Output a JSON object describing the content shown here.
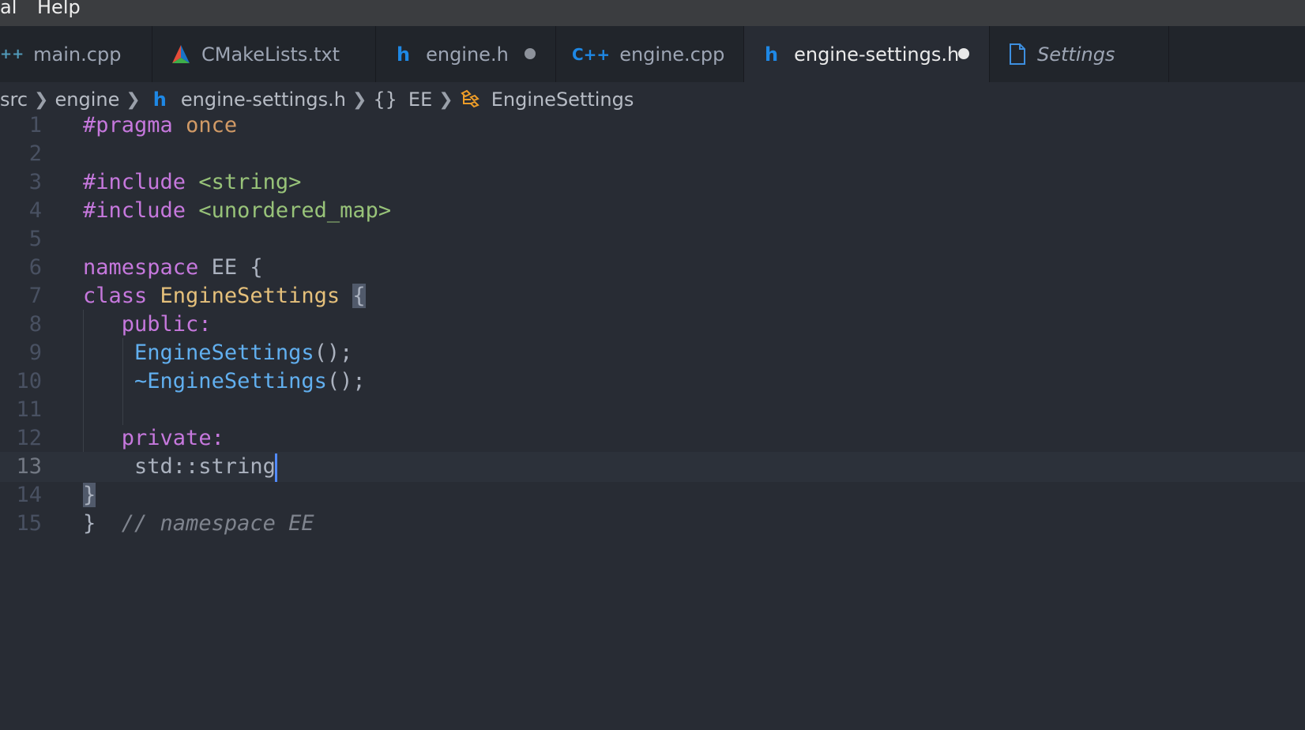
{
  "menubar": {
    "items": [
      {
        "label": "al"
      },
      {
        "label": "Help"
      }
    ]
  },
  "tabs": [
    {
      "label": "main.cpp",
      "icon": "cpp-icon",
      "icon_text": "++",
      "icon_color": "#519aba",
      "dirty": false,
      "active": false,
      "italic": false
    },
    {
      "label": "CMakeLists.txt",
      "icon": "cmake-icon",
      "icon_text": "",
      "icon_color": "#e44d3a",
      "dirty": false,
      "active": false,
      "italic": false
    },
    {
      "label": "engine.h",
      "icon": "header-icon",
      "icon_text": "h",
      "icon_color": "#1e88e5",
      "dirty": true,
      "active": false,
      "italic": false
    },
    {
      "label": "engine.cpp",
      "icon": "cpp-icon",
      "icon_text": "C++",
      "icon_color": "#1e88e5",
      "dirty": false,
      "active": false,
      "italic": false
    },
    {
      "label": "engine-settings.h",
      "icon": "header-icon",
      "icon_text": "h",
      "icon_color": "#1e88e5",
      "dirty": true,
      "active": true,
      "italic": false
    },
    {
      "label": "Settings",
      "icon": "file-icon",
      "icon_text": "",
      "icon_color": "#3d8fe0",
      "dirty": false,
      "active": false,
      "italic": true
    }
  ],
  "breadcrumb": {
    "items": [
      {
        "label": "src"
      },
      {
        "label": "engine"
      },
      {
        "label": "engine-settings.h",
        "icon_text": "h"
      },
      {
        "label": "EE",
        "icon_text": "{}"
      },
      {
        "label": "EngineSettings",
        "icon": "class-icon"
      }
    ]
  },
  "editor": {
    "cursor": {
      "line": 13
    },
    "lines": [
      {
        "n": "1",
        "tokens": [
          [
            "kw",
            "#pragma"
          ],
          [
            "plain",
            " "
          ],
          [
            "orange",
            "once"
          ]
        ]
      },
      {
        "n": "2",
        "tokens": []
      },
      {
        "n": "3",
        "tokens": [
          [
            "kw",
            "#include"
          ],
          [
            "plain",
            " "
          ],
          [
            "str",
            "<string>"
          ]
        ]
      },
      {
        "n": "4",
        "tokens": [
          [
            "kw",
            "#include"
          ],
          [
            "plain",
            " "
          ],
          [
            "str",
            "<unordered_map>"
          ]
        ]
      },
      {
        "n": "5",
        "tokens": []
      },
      {
        "n": "6",
        "tokens": [
          [
            "kw",
            "namespace"
          ],
          [
            "plain",
            " EE {"
          ]
        ]
      },
      {
        "n": "7",
        "tokens": [
          [
            "kw",
            "class"
          ],
          [
            "plain",
            " "
          ],
          [
            "cls",
            "EngineSettings"
          ],
          [
            "plain",
            " "
          ],
          [
            "hl",
            "{"
          ]
        ]
      },
      {
        "n": "8",
        "tokens": [
          [
            "plain",
            "   "
          ],
          [
            "kw",
            "public:"
          ]
        ]
      },
      {
        "n": "9",
        "tokens": [
          [
            "plain",
            "    "
          ],
          [
            "fn",
            "EngineSettings"
          ],
          [
            "plain",
            "();"
          ]
        ]
      },
      {
        "n": "10",
        "tokens": [
          [
            "plain",
            "    "
          ],
          [
            "fn",
            "~EngineSettings"
          ],
          [
            "plain",
            "();"
          ]
        ]
      },
      {
        "n": "11",
        "tokens": []
      },
      {
        "n": "12",
        "tokens": [
          [
            "plain",
            "   "
          ],
          [
            "kw",
            "private:"
          ]
        ]
      },
      {
        "n": "13",
        "tokens": [
          [
            "plain",
            "    std::string"
          ]
        ]
      },
      {
        "n": "14",
        "tokens": [
          [
            "hl",
            "}"
          ]
        ]
      },
      {
        "n": "15",
        "tokens": [
          [
            "plain",
            "}  "
          ],
          [
            "cmt",
            "// namespace EE"
          ]
        ]
      }
    ]
  },
  "colors": {
    "background": "#282c34",
    "tabbar": "#21252b",
    "menubar": "#3b3d40",
    "keyword": "#c678dd",
    "string": "#98c379",
    "class": "#e5c07b",
    "function": "#61afef",
    "comment": "#7f848e",
    "cursor": "#528bff"
  }
}
